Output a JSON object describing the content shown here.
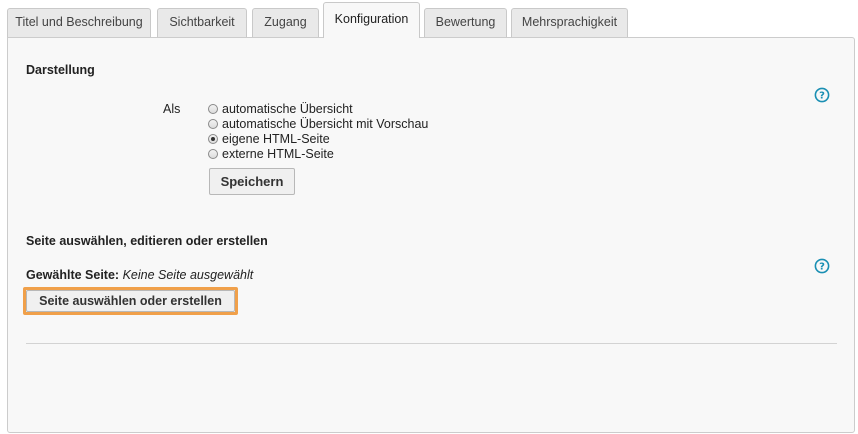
{
  "tabs": [
    {
      "label": "Titel und Beschreibung",
      "active": false
    },
    {
      "label": "Sichtbarkeit",
      "active": false
    },
    {
      "label": "Zugang",
      "active": false
    },
    {
      "label": "Konfiguration",
      "active": true
    },
    {
      "label": "Bewertung",
      "active": false
    },
    {
      "label": "Mehrsprachigkeit",
      "active": false
    }
  ],
  "display_section": {
    "title": "Darstellung",
    "as_label": "Als",
    "options": [
      {
        "label": "automatische Übersicht",
        "checked": false
      },
      {
        "label": "automatische Übersicht mit Vorschau",
        "checked": false
      },
      {
        "label": "eigene HTML-Seite",
        "checked": true
      },
      {
        "label": "externe HTML-Seite",
        "checked": false
      }
    ],
    "save_label": "Speichern"
  },
  "page_section": {
    "title": "Seite auswählen, editieren oder erstellen",
    "selected_label": "Gewählte Seite:",
    "selected_value": "Keine Seite ausgewählt",
    "select_button_label": "Seite auswählen oder erstellen"
  },
  "colors": {
    "help_icon": "#1a8fb3",
    "highlight": "#f0a04a"
  },
  "icons": {
    "help": "help-circle-icon"
  }
}
